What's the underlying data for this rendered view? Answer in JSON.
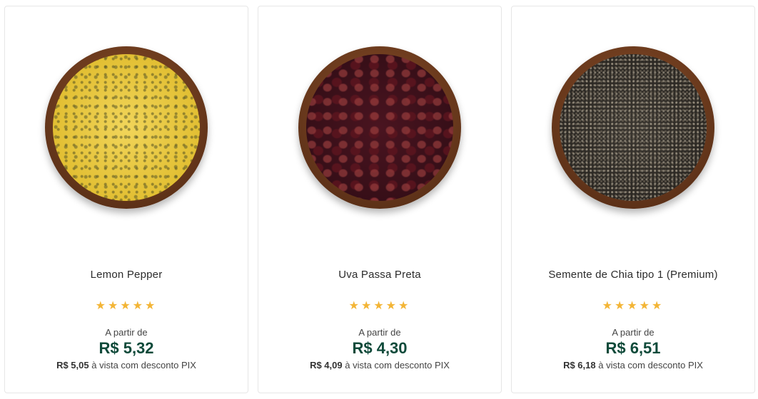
{
  "products": [
    {
      "name": "Lemon Pepper",
      "image": "lemon-pepper-bowl",
      "rating": 5,
      "from_label": "A partir de",
      "price": "R$ 5,32",
      "pix_price": "R$ 5,05",
      "pix_label": "à vista com desconto PIX"
    },
    {
      "name": "Uva Passa Preta",
      "image": "black-raisin-bowl",
      "rating": 5,
      "from_label": "A partir de",
      "price": "R$ 4,30",
      "pix_price": "R$ 4,09",
      "pix_label": "à vista com desconto PIX"
    },
    {
      "name": "Semente de Chia tipo 1 (Premium)",
      "image": "chia-seed-bowl",
      "rating": 5,
      "from_label": "A partir de",
      "price": "R$ 6,51",
      "pix_price": "R$ 6,18",
      "pix_label": "à vista com desconto PIX"
    }
  ],
  "colors": {
    "price": "#0f4a3a",
    "star": "#f3b536",
    "card_border": "#e6e6e6"
  }
}
